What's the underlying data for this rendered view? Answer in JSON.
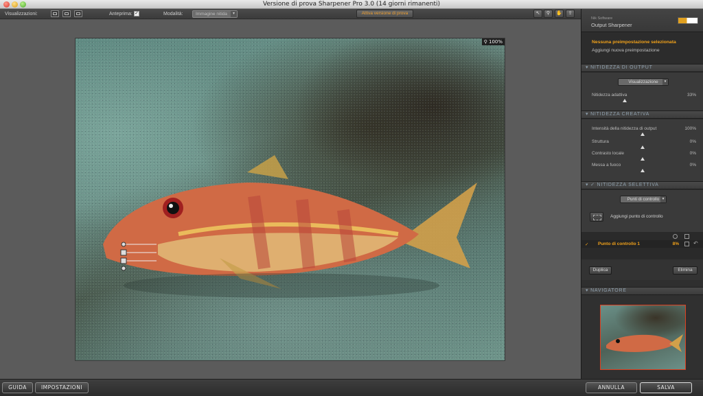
{
  "window": {
    "title": "Versione di prova Sharpener Pro 3.0 (14 giorni rimanenti)"
  },
  "toolbar": {
    "views_label": "Visualizzazioni:",
    "preview_label": "Anteprima:",
    "preview_checked": true,
    "mode_label": "Modalità:",
    "mode_value": "Immagine nitida",
    "trial_button": "Attiva versione di prova",
    "tools": [
      "pointer-icon",
      "zoom-icon",
      "hand-icon",
      "control-point-tool-icon"
    ]
  },
  "canvas": {
    "zoom": "100%"
  },
  "panel": {
    "brand_small": "Nik Software",
    "brand_title": "Output Sharpener",
    "presets": {
      "selected": "Nessuna preimpostazione selezionata",
      "add": "Aggiungi nuova preimpostazione"
    },
    "output": {
      "header": "NITIDEZZA DI OUTPUT",
      "dropdown": "Visualizzazione",
      "slider_label": "Nitidezza adattiva",
      "slider_value": "33%"
    },
    "creative": {
      "header": "NITIDEZZA CREATIVA",
      "sliders": [
        {
          "label": "Intensità della nitidezza di output",
          "value": "100%"
        },
        {
          "label": "Struttura",
          "value": "0%"
        },
        {
          "label": "Contrasto locale",
          "value": "0%"
        },
        {
          "label": "Messa a fuoco",
          "value": "0%"
        }
      ]
    },
    "selective": {
      "header": "NITIDEZZA SELETTIVA",
      "checkmark": "✓",
      "dropdown": "Punti di controllo",
      "add_point_label": "Aggiungi punto di controllo",
      "row_check": "✓",
      "row_name": "Punto di controllo 1",
      "row_value": "8%",
      "duplicate": "Duplica",
      "delete": "Elimina"
    },
    "navigator": {
      "header": "NAVIGATORE"
    }
  },
  "bottom": {
    "help": "GUIDA",
    "settings": "IMPOSTAZIONI",
    "cancel": "ANNULLA",
    "save": "SALVA"
  },
  "colors": {
    "accent": "#f2a21a",
    "section_text": "#8fa0ad"
  }
}
